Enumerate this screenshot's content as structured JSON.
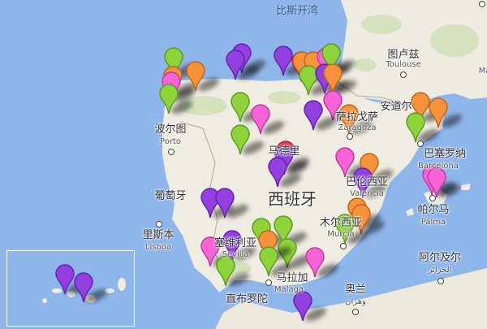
{
  "map": {
    "labels": {
      "biscay": "比斯开湾",
      "toulouse_zh": "图卢兹",
      "toulouse_en": "Toulouse",
      "porto_zh": "波尔图",
      "porto_en": "Porto",
      "andorra_zh": "安道尔",
      "zaragoza_zh": "萨拉戈萨",
      "zaragoza_en": "Zaragoza",
      "barcelona_zh": "巴塞罗纳",
      "barcelona_en": "Barcelona",
      "madrid_zh": "马德里",
      "valencia_zh": "巴伦西亚",
      "valencia_en": "Valencia",
      "spain_zh": "西班牙",
      "portugal_zh": "葡萄牙",
      "lisbon_zh": "里斯本",
      "lisbon_en": "Lisboa",
      "seville_zh": "塞维利亚",
      "seville_en": "Sevilla",
      "murcia_zh": "木尔西亚",
      "murcia_en": "Murcia",
      "palma_zh": "帕尔马",
      "palma_en": "Palma",
      "malaga_zh": "马拉加",
      "malaga_en": "Malaga",
      "gibraltar_zh": "直布罗陀",
      "oran_zh": "奥兰",
      "oran_ar": "وهران",
      "algiers_zh": "阿尔及尔",
      "algiers_ar": "الجزائر",
      "partial_right": "Ma"
    },
    "colors": {
      "green": "#8fd33a",
      "orange": "#f7923c",
      "pink": "#f763d6",
      "purple": "#9340e0",
      "red": "#e8344a"
    },
    "markers": [
      "green",
      "orange",
      "pink",
      "green",
      "orange",
      "purple",
      "purple",
      "purple",
      "red",
      "orange",
      "orange",
      "pink",
      "green",
      "green",
      "purple",
      "orange",
      "pink",
      "purple",
      "orange",
      "green",
      "green",
      "pink",
      "orange",
      "orange",
      "green",
      "red",
      "purple",
      "purple",
      "pink",
      "orange",
      "purple",
      "pink",
      "pink",
      "purple",
      "purple",
      "orange",
      "orange",
      "green",
      "green",
      "green",
      "green",
      "pink",
      "purple",
      "green",
      "orange",
      "green",
      "pink",
      "purple",
      "purple",
      "purple"
    ]
  }
}
